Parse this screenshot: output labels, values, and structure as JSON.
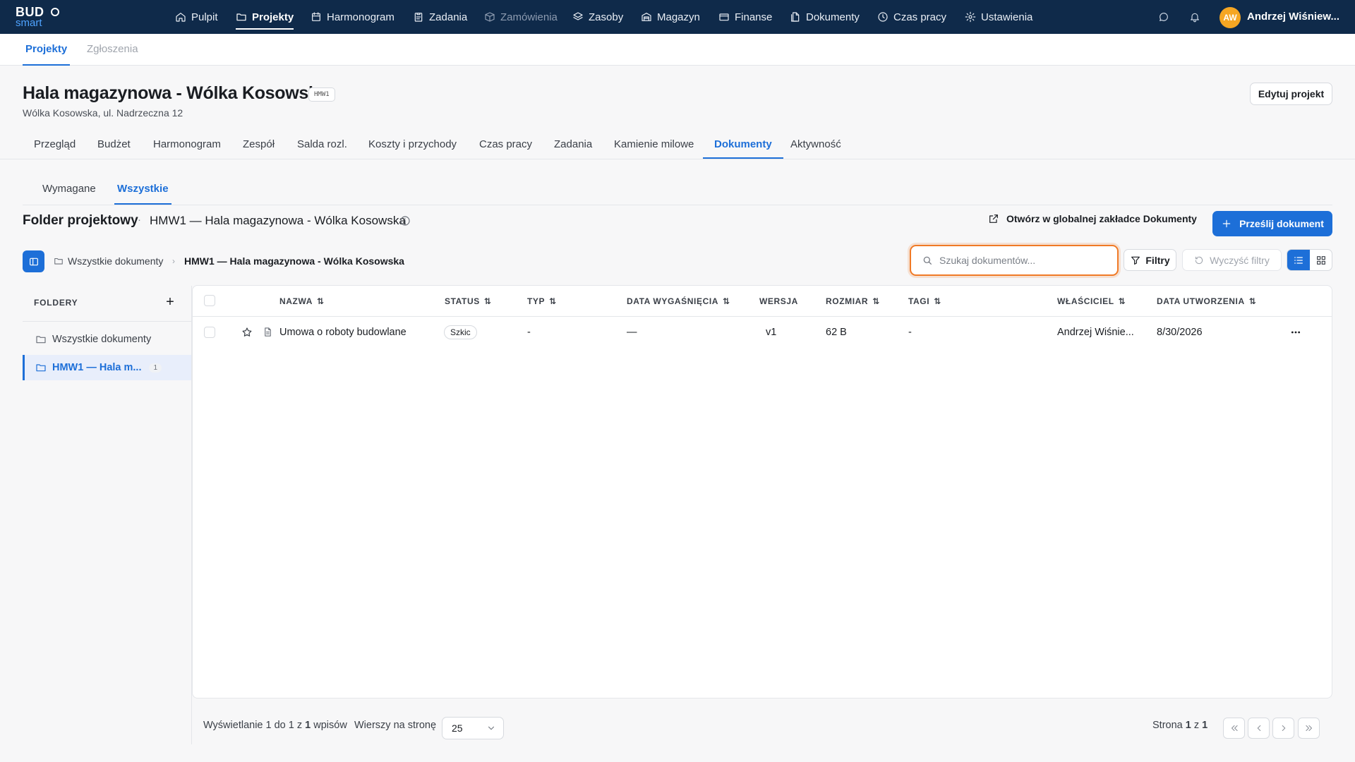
{
  "brand": {
    "line1": "BUD",
    "line2": "smart"
  },
  "nav": {
    "items": [
      {
        "label": "Pulpit",
        "icon": "home-icon"
      },
      {
        "label": "Projekty",
        "icon": "folder-icon"
      },
      {
        "label": "Harmonogram",
        "icon": "calendar-icon"
      },
      {
        "label": "Zadania",
        "icon": "clipboard-icon"
      },
      {
        "label": "Zamówienia",
        "icon": "box-icon"
      },
      {
        "label": "Zasoby",
        "icon": "layers-icon"
      },
      {
        "label": "Magazyn",
        "icon": "warehouse-icon"
      },
      {
        "label": "Finanse",
        "icon": "wallet-icon"
      },
      {
        "label": "Dokumenty",
        "icon": "documents-icon"
      },
      {
        "label": "Czas pracy",
        "icon": "clock-icon"
      },
      {
        "label": "Ustawienia",
        "icon": "gear-icon"
      }
    ],
    "active": "Projekty",
    "disabled": "Zamówienia"
  },
  "user": {
    "initials": "AW",
    "name": "Andrzej Wiśniew..."
  },
  "subnav": {
    "tabs": [
      "Projekty",
      "Zgłoszenia"
    ],
    "active": "Projekty"
  },
  "project": {
    "title": "Hala magazynowa - Wólka Kosowska",
    "code": "HMW1",
    "address": "Wólka Kosowska, ul. Nadrzeczna 12",
    "edit_label": "Edytuj projekt",
    "tabs": [
      "Przegląd",
      "Budżet",
      "Harmonogram",
      "Zespół",
      "Salda rozl.",
      "Koszty i przychody",
      "Czas pracy",
      "Zadania",
      "Kamienie milowe",
      "Dokumenty",
      "Aktywność"
    ],
    "active_tab": "Dokumenty"
  },
  "documents": {
    "tabs": [
      "Wymagane",
      "Wszystkie"
    ],
    "active_tab": "Wszystkie",
    "folder_heading": "Folder projektowy",
    "separator": "·",
    "folder_path": "HMW1 — Hala magazynowa - Wólka Kosowska",
    "open_global": "Otwórz w globalnej zakładce Dokumenty",
    "upload": "Prześlij dokument",
    "breadcrumb": [
      "Wszystkie dokumenty",
      "HMW1 — Hala magazynowa - Wólka Kosowska"
    ],
    "search_placeholder": "Szukaj dokumentów...",
    "filters_label": "Filtry",
    "clear_filters_label": "Wyczyść filtry"
  },
  "folders": {
    "heading": "FOLDERY",
    "add": "+",
    "items": [
      {
        "label": "Wszystkie dokumenty",
        "count": ""
      },
      {
        "label": "HMW1 — Hala m...",
        "count": "1"
      }
    ]
  },
  "table": {
    "columns": [
      "NAZWA",
      "STATUS",
      "TYP",
      "DATA WYGAŚNIĘCIA",
      "WERSJA",
      "ROZMIAR",
      "TAGI",
      "WŁAŚCICIEL",
      "DATA UTWORZENIA"
    ],
    "rows": [
      {
        "name": "Umowa o roboty budowlane",
        "status": "Szkic",
        "type": "-",
        "expiry": "—",
        "version": "v1",
        "size": "62 B",
        "tags": "-",
        "owner": "Andrzej Wiśnie...",
        "created": "8/30/2026"
      }
    ]
  },
  "footer": {
    "showing_prefix": "Wyświetlanie 1 do 1 z ",
    "showing_total": "1",
    "showing_suffix": " wpisów",
    "rows_per_page_label": "Wierszy na stronę",
    "rows_per_page": "25",
    "page_prefix": "Strona ",
    "page_current": "1",
    "page_mid": " z ",
    "page_total": "1"
  },
  "colors": {
    "nav_bg": "#0f2a4a",
    "accent": "#1d6fd8",
    "search_focus": "#f07a26",
    "avatar": "#f5a623"
  }
}
